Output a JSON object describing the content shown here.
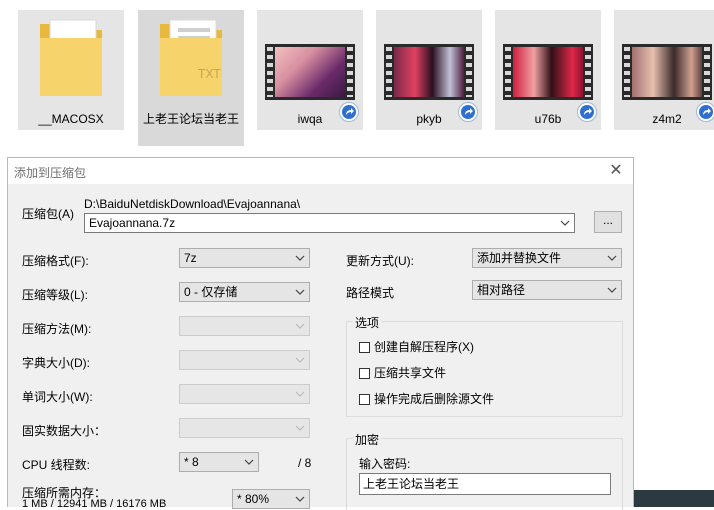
{
  "files": [
    {
      "name": "__MACOSX",
      "type": "folder",
      "icon": "folder-icon"
    },
    {
      "name": "上老王论坛当老王",
      "type": "folder",
      "icon": "folder-icon"
    },
    {
      "name": "iwqa",
      "type": "video",
      "icon": "video-thumbnail"
    },
    {
      "name": "pkyb",
      "type": "video",
      "icon": "video-thumbnail"
    },
    {
      "name": "u76b",
      "type": "video",
      "icon": "video-thumbnail"
    },
    {
      "name": "z4m2",
      "type": "video",
      "icon": "video-thumbnail"
    }
  ],
  "dialog": {
    "title": "添加到压缩包",
    "close_glyph": "✕",
    "archive_label": "压缩包(A)",
    "archive_dir": "D:\\BaiduNetdiskDownload\\Evajoannana\\",
    "archive_name": "Evajoannana.7z",
    "browse_label": "...",
    "format_label": "压缩格式(F):",
    "format_value": "7z",
    "level_label": "压缩等级(L):",
    "level_value": "0 - 仅存储",
    "method_label": "压缩方法(M):",
    "dict_label": "字典大小(D):",
    "word_label": "单词大小(W):",
    "solid_label": "固实数据大小：",
    "cpu_label": "CPU 线程数:",
    "cpu_value": "* 8",
    "cpu_total": "/ 8",
    "mem_label": "压缩所需内存：",
    "mem_value": "1 MB / 12941 MB / 16176 MB",
    "mem_percent": "* 80%",
    "update_label": "更新方式(U):",
    "update_value": "添加并替换文件",
    "path_label": "路径模式",
    "path_value": "相对路径",
    "options_title": "选项",
    "opt_sfx": "创建自解压程序(X)",
    "opt_shared": "压缩共享文件",
    "opt_delete": "操作完成后删除源文件",
    "encrypt_title": "加密",
    "password_label": "输入密码:",
    "password_value": "上老王论坛当老王"
  },
  "colors": {
    "dialog_bg": "#f0f0f0",
    "selection_bg": "#d9d9d9",
    "folder_yellow": "#f6d46b",
    "shortcut_blue": "#2f6fd0"
  }
}
